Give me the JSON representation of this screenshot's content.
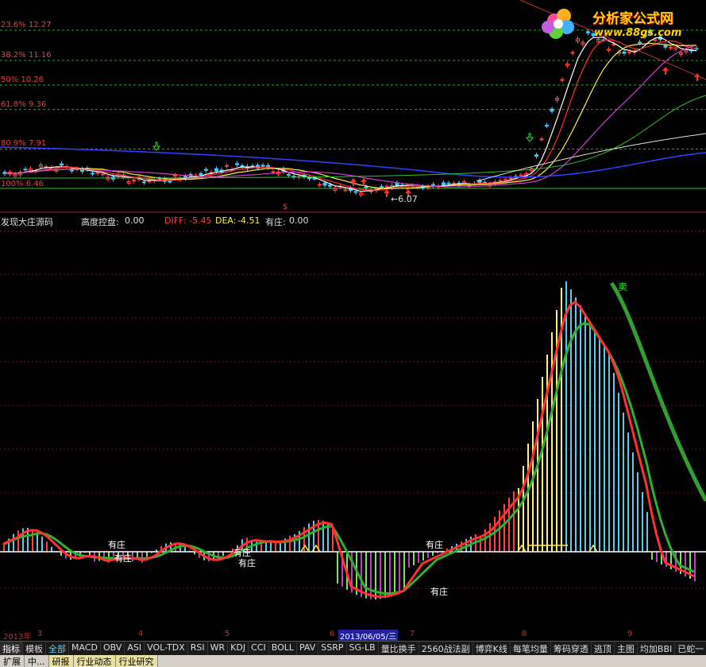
{
  "upper_chart": {
    "fib_levels": [
      {
        "label": "23.6% 12.27",
        "price": 12.27
      },
      {
        "label": "38.2% 11.16",
        "price": 11.16
      },
      {
        "label": "50% 10.26",
        "price": 10.26
      },
      {
        "label": "61.8% 9.36",
        "price": 9.36
      },
      {
        "label": "80.9% 7.91",
        "price": 7.91
      },
      {
        "label": "100% 6.46",
        "price": 6.46
      }
    ],
    "low_marker": "←6.07",
    "dollar_marker": "$"
  },
  "indicator": {
    "name": "发现大庄源码",
    "height_label": "高度控盘:",
    "height_value": "0.00",
    "diff_label": "DIFF:",
    "diff_value": "-5.45",
    "dea_label": "DEA:",
    "dea_value": "-4.51",
    "zhuang_label": "有庄:",
    "zhuang_value": "0.00",
    "annotations": [
      "有庄",
      "有庄",
      "有庄",
      "有庄",
      "有庄",
      "有庄"
    ],
    "sell_label": "卖",
    "colors": {
      "diff": "#ff3030",
      "dea": "#ffee44",
      "rise": "#ff3030",
      "fall": "#30c0ff",
      "zero": "#ffffff"
    }
  },
  "date_axis": {
    "start": "2013年",
    "months": [
      "3",
      "4",
      "5",
      "6",
      "7",
      "8",
      "9"
    ],
    "selected": "2013/06/05/三"
  },
  "tabs": [
    {
      "label": "指标"
    },
    {
      "label": "模板"
    },
    {
      "label": "全部"
    },
    {
      "label": "MACD"
    },
    {
      "label": "OBV"
    },
    {
      "label": "ASI"
    },
    {
      "label": "VOL-TDX"
    },
    {
      "label": "RSI"
    },
    {
      "label": "WR"
    },
    {
      "label": "KDJ"
    },
    {
      "label": "CCI"
    },
    {
      "label": "BOLL"
    },
    {
      "label": "PAV"
    },
    {
      "label": "SSRP"
    },
    {
      "label": "SG-LB"
    },
    {
      "label": "量比换手"
    },
    {
      "label": "2560战法副"
    },
    {
      "label": "博弈K线"
    },
    {
      "label": "每笔均量"
    },
    {
      "label": "筹码穿透"
    },
    {
      "label": "逃顶"
    },
    {
      "label": "主图"
    },
    {
      "label": "均加BBI"
    },
    {
      "label": "已蛇一"
    }
  ],
  "bottom_tabs": [
    {
      "label": "扩展"
    },
    {
      "label": "中..."
    },
    {
      "label": "研报"
    },
    {
      "label": "行业动态"
    },
    {
      "label": "行业研究"
    }
  ],
  "logo": {
    "text": "分析家公式网",
    "url_text": "www.88gs.com"
  }
}
